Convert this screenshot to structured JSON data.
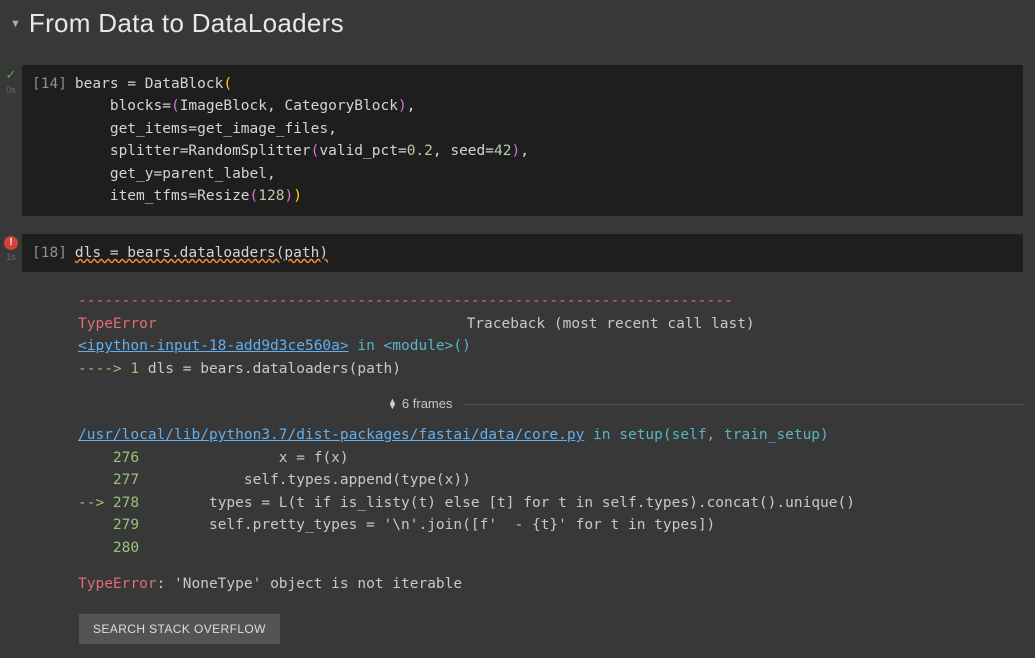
{
  "section": {
    "title": "From Data to DataLoaders"
  },
  "cell1": {
    "exec_no": "[14]",
    "status_icon": "✓",
    "elapsed": "0s",
    "code": "bears = DataBlock(\n    blocks=(ImageBlock, CategoryBlock),\n    get_items=get_image_files,\n    splitter=RandomSplitter(valid_pct=0.2, seed=42),\n    get_y=parent_label,\n    item_tfms=Resize(128))"
  },
  "cell2": {
    "exec_no": "[18]",
    "status_icon": "!",
    "elapsed": "1s",
    "code": "dls = bears.dataloaders(path)"
  },
  "traceback": {
    "separator": "---------------------------------------------------------------------------",
    "exc_type": "TypeError",
    "header_right": "Traceback (most recent call last)",
    "top_link": "<ipython-input-18-add9d3ce560a>",
    "top_suffix": " in <module>()",
    "top_arrow": "----> 1 ",
    "top_code": "dls = bears.dataloaders(path)",
    "frames_label": "6 frames",
    "file_link": "/usr/local/lib/python3.7/dist-packages/fastai/data/core.py",
    "file_suffix": " in setup(self, train_setup)",
    "lines": [
      {
        "arrow": "    ",
        "ln": "276",
        "code": "                x = f(x)"
      },
      {
        "arrow": "    ",
        "ln": "277",
        "code": "            self.types.append(type(x))"
      },
      {
        "arrow": "--> ",
        "ln": "278",
        "code": "        types = L(t if is_listy(t) else [t] for t in self.types).concat().unique()"
      },
      {
        "arrow": "    ",
        "ln": "279",
        "code": "        self.pretty_types = '\\n'.join([f'  - {t}' for t in types])"
      },
      {
        "arrow": "    ",
        "ln": "280",
        "code": ""
      }
    ],
    "final_type": "TypeError",
    "final_msg": ": 'NoneType' object is not iterable",
    "button": "SEARCH STACK OVERFLOW"
  }
}
